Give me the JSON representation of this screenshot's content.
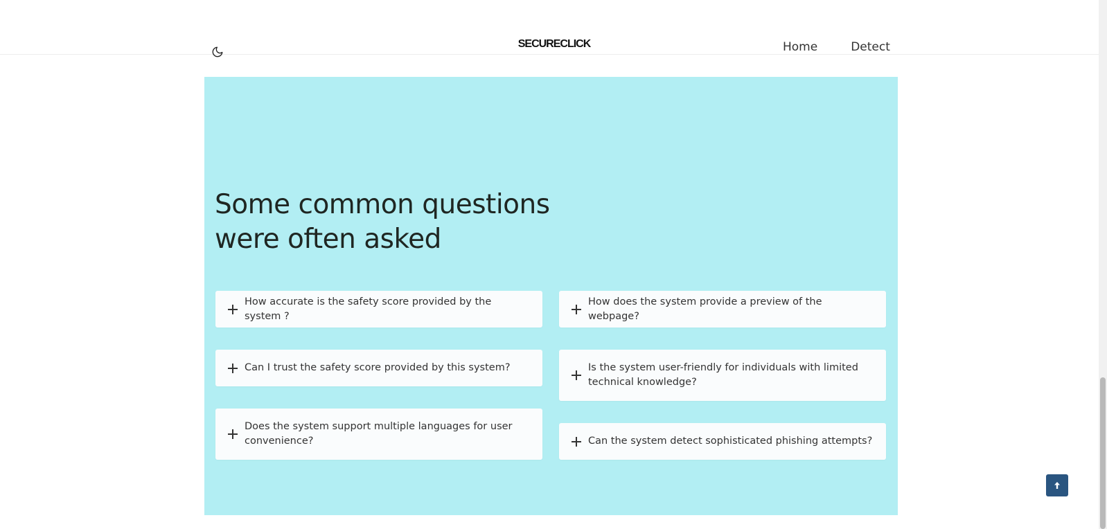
{
  "header": {
    "brand": "SECURECLICK",
    "nav": [
      {
        "label": "Home"
      },
      {
        "label": "Detect"
      }
    ],
    "theme_icon": "moon-icon"
  },
  "faq": {
    "title": "Some common questions were often asked",
    "items": [
      {
        "question": "How accurate is the safety score provided by the system ?"
      },
      {
        "question": "How does the system provide a preview of the webpage?"
      },
      {
        "question": "Can I trust the safety score provided by this system?"
      },
      {
        "question": "Is the system user-friendly for individuals with limited technical knowledge?"
      },
      {
        "question": "Does the system support multiple languages for user convenience?"
      },
      {
        "question": "Can the system detect sophisticated phishing attempts?"
      }
    ],
    "expand_icon": "plus-icon",
    "background_color": "#b2eef3"
  },
  "scroll_top": {
    "icon": "arrow-up-icon",
    "color": "#2a5580"
  }
}
